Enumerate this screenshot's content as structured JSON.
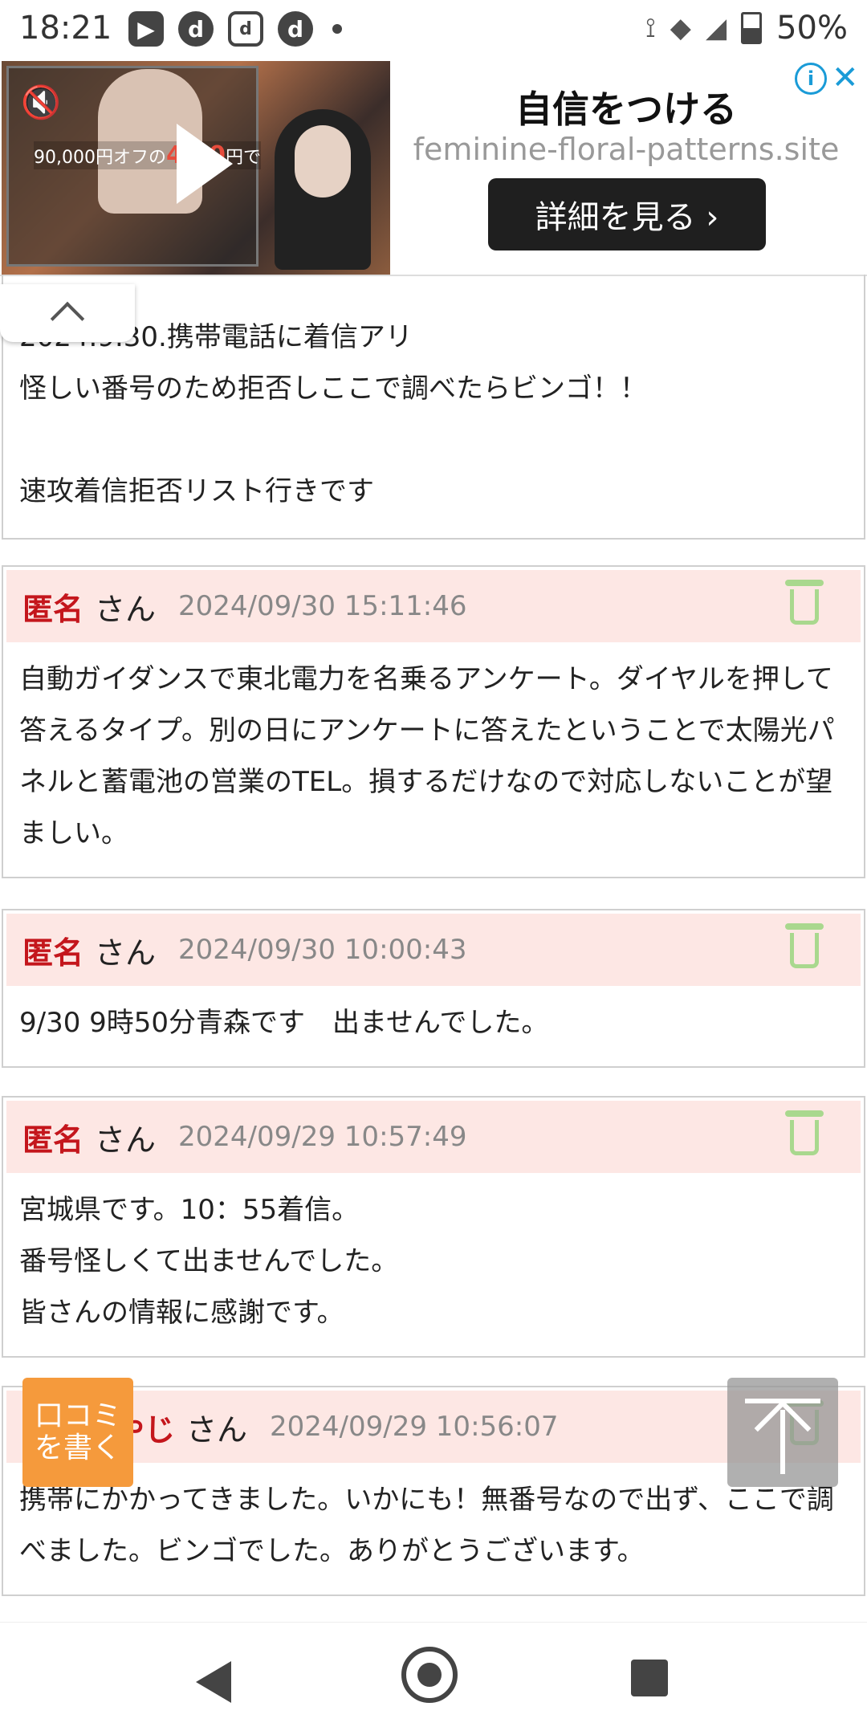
{
  "status_bar": {
    "time": "18:21",
    "battery": "50%",
    "left_icons": [
      "youtube-icon",
      "d-icon",
      "d-outline-icon",
      "d-icon"
    ],
    "right_icons": [
      "nfc-icon",
      "signal-icon",
      "cell-icon",
      "battery-icon"
    ]
  },
  "ad": {
    "video_price_text": "90,000円オフの",
    "video_price_highlight": "4,80",
    "video_price_suffix": "円で",
    "headline": "自信をつける",
    "domain": "feminine-floral-patterns.site",
    "cta_label": "詳細を見る ›",
    "info_glyph": "i",
    "close_glyph": "✕"
  },
  "top_card": {
    "partial_text": "2024.9.30.携帯電話に着信アリ\n怪しい番号のため拒否しここで調べたらビンゴ！！\n\n速攻着信拒否リスト行きです"
  },
  "comments": [
    {
      "name": "匿名",
      "suffix": "さん",
      "date": "2024/09/30 15:11:46",
      "body": "自動ガイダンスで東北電力を名乗るアンケート。ダイヤルを押して答えるタイプ。別の日にアンケートに答えたということで太陽光パネルと蓄電池の営業のTEL。損するだけなので対応しないことが望ましい。"
    },
    {
      "name": "匿名",
      "suffix": "さん",
      "date": "2024/09/30 10:00:43",
      "body": "9/30 9時50分青森です　出ませんでした。"
    },
    {
      "name": "匿名",
      "suffix": "さん",
      "date": "2024/09/29 10:57:49",
      "body": "宮城県です。10：55着信。\n番号怪しくて出ませんでした。\n皆さんの情報に感謝です。"
    },
    {
      "name": "嫌なおやじ",
      "suffix": "さん",
      "date": "2024/09/29 10:56:07",
      "body": "携帯にかかってきました。いかにも！無番号なので出ず、ここで調べました。ビンゴでした。ありがとうございます。"
    }
  ],
  "floating": {
    "write_review": "口コミを書く"
  },
  "colors": {
    "name_red": "#c4161c",
    "header_pink": "#fde7e4",
    "trash_green": "#a9d88e",
    "fab_orange": "#f59a3c"
  }
}
